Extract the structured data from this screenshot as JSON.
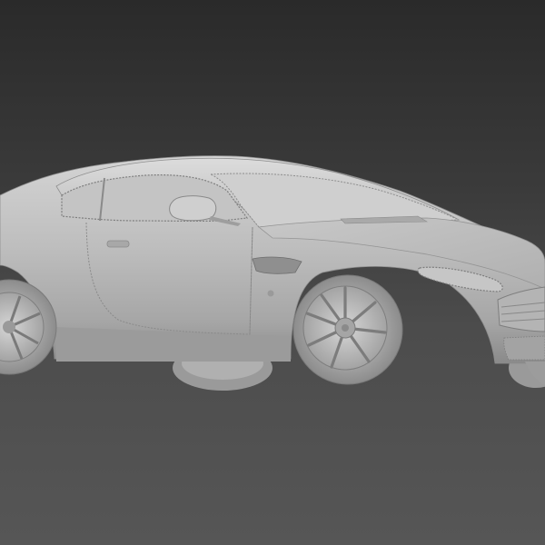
{
  "viewport": {
    "background_top": "#2a2a2a",
    "background_bottom": "#565656"
  },
  "model": {
    "subject": "car-3d-model",
    "shading": "matte-grey-clay",
    "body_color": "#b9b9b9",
    "shadow_color": "#6e6e6e",
    "highlight_color": "#dedede"
  }
}
